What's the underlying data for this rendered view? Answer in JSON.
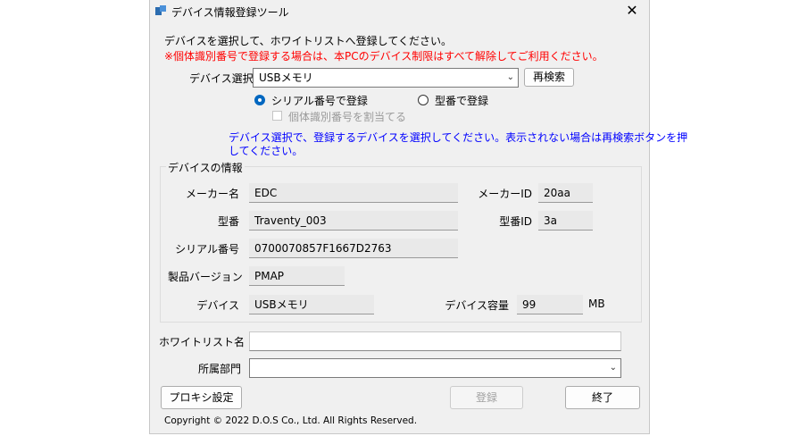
{
  "window": {
    "title": "デバイス情報登録ツール",
    "close_glyph": "✕"
  },
  "instructions": {
    "line1": "デバイスを選択して、ホワイトリストへ登録してください。",
    "line2": "※個体識別番号で登録する場合は、本PCのデバイス制限はすべて解除してご利用ください。"
  },
  "device_select": {
    "label": "デバイス選択",
    "value": "USBメモリ",
    "rescan_button": "再検索"
  },
  "register_mode": {
    "serial_label": "シリアル番号で登録",
    "serial_selected": true,
    "model_label": "型番で登録",
    "assign_id_label": "個体識別番号を割当てる"
  },
  "hint": {
    "line1": "デバイス選択で、登録するデバイスを選択してください。表示されない場合は再検索ボタンを押",
    "line2": "してください。"
  },
  "device_info": {
    "group_label": "デバイスの情報",
    "maker_name_label": "メーカー名",
    "maker_name": "EDC",
    "maker_id_label": "メーカーID",
    "maker_id": "20aa",
    "model_label": "型番",
    "model": "Traventy_003",
    "model_id_label": "型番ID",
    "model_id": "3a",
    "serial_label": "シリアル番号",
    "serial": "0700070857F1667D2763",
    "version_label": "製品バージョン",
    "version": "PMAP",
    "device_label": "デバイス",
    "device": "USBメモリ",
    "capacity_label": "デバイス容量",
    "capacity": "99",
    "capacity_unit": "MB"
  },
  "form": {
    "whitelist_label": "ホワイトリスト名",
    "whitelist_value": "",
    "department_label": "所属部門",
    "department_value": ""
  },
  "buttons": {
    "proxy": "プロキシ設定",
    "register": "登録",
    "exit": "終了"
  },
  "footer": {
    "copyright": "Copyright © 2022 D.O.S Co., Ltd. All Rights Reserved."
  },
  "colors": {
    "warning": "#ff0000",
    "hint": "#0000ff",
    "accent": "#0067c0"
  }
}
